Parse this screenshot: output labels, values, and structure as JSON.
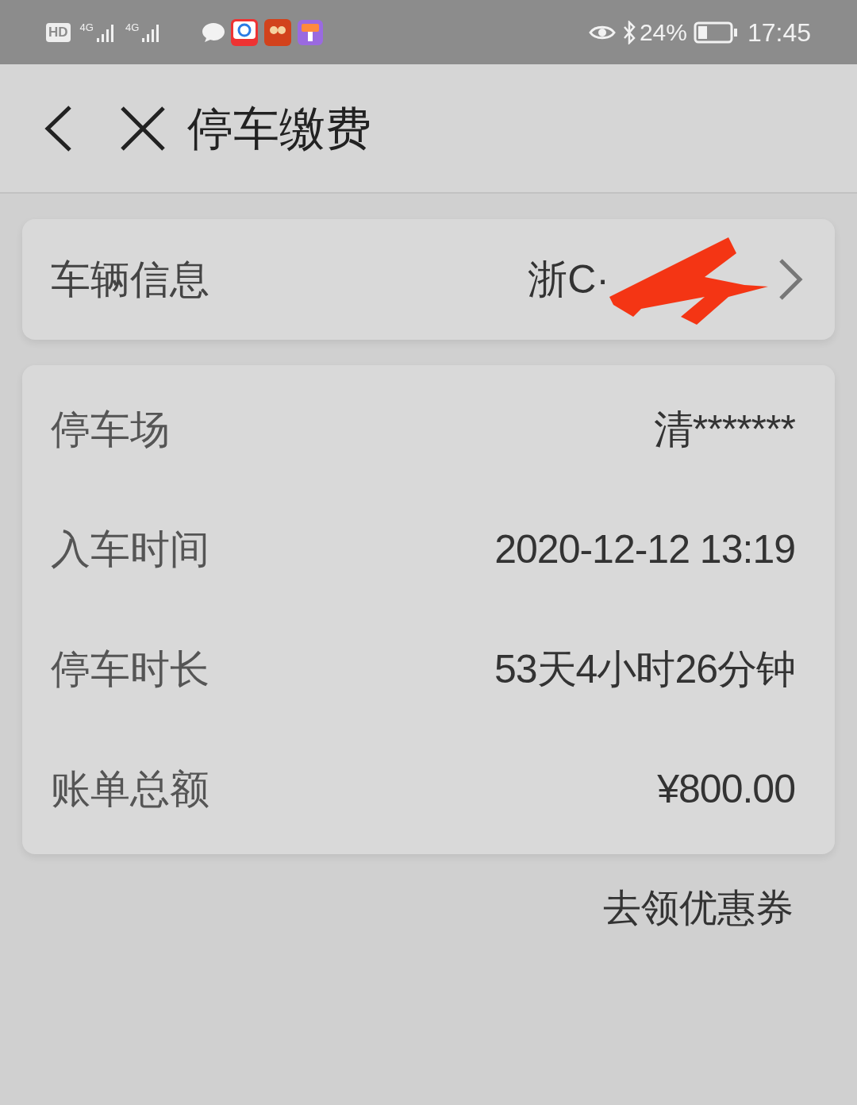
{
  "status_bar": {
    "hd": "HD",
    "sim_labels": [
      "4G",
      "4G"
    ],
    "battery": "24%",
    "time": "17:45"
  },
  "header": {
    "title": "停车缴费"
  },
  "vehicle": {
    "label": "车辆信息",
    "plate_visible": "浙C·"
  },
  "details": [
    {
      "label": "停车场",
      "value": "清*******"
    },
    {
      "label": "入车时间",
      "value": "2020-12-12 13:19"
    },
    {
      "label": "停车时长",
      "value": "53天4小时26分钟"
    },
    {
      "label": "账单总额",
      "value": "¥800.00"
    }
  ],
  "coupon_link": "去领优惠券"
}
